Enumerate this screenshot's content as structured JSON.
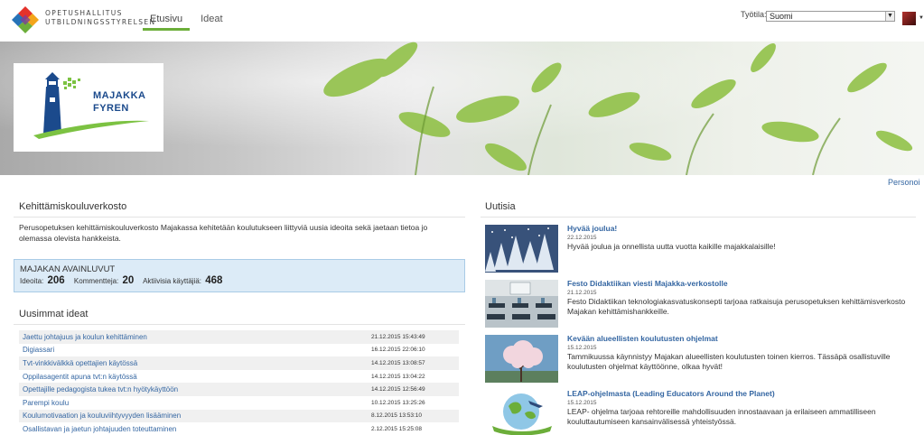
{
  "header": {
    "logo_line1": "OPETUSHALLITUS",
    "logo_line2": "UTBILDNINGSSTYRELSEN",
    "nav": [
      {
        "label": "Etusivu",
        "active": true
      },
      {
        "label": "Ideat",
        "active": false
      }
    ],
    "worklist_label": "Työtila:",
    "worklist_value": "Suomi",
    "accent_color": "#6cae3a",
    "link_color": "#3466a2"
  },
  "banner": {
    "brand_name1": "MAJAKKA",
    "brand_name2": "FYREN",
    "personalize_label": "Personoi"
  },
  "left": {
    "section_title": "Kehittämiskouluverkosto",
    "intro": "Perusopetuksen kehittämiskouluverkosto Majakassa kehitetään koulutukseen liittyviä uusia ideoita sekä jaetaan tietoa jo olemassa olevista hankkeista.",
    "keyfigures": {
      "title": "MAJAKAN AVAINLUVUT",
      "ideas_label": "Ideoita:",
      "ideas_value": "206",
      "comments_label": "Kommentteja:",
      "comments_value": "20",
      "users_label": "Aktiivisia käyttäjiä:",
      "users_value": "468"
    },
    "latest_title": "Uusimmat ideat",
    "ideas": [
      {
        "title": "Jaettu johtajuus ja koulun kehittäminen",
        "date": "21.12.2015 15:43:49"
      },
      {
        "title": "Digiassari",
        "date": "16.12.2015 22:06:10"
      },
      {
        "title": "Tvt-vinkkivälkkä opettajien käytössä",
        "date": "14.12.2015 13:08:57"
      },
      {
        "title": "Oppilasagentit apuna tvt:n käytössä",
        "date": "14.12.2015 13:04:22"
      },
      {
        "title": "Opettajille pedagogista tukea tvt:n hyötykäyttöön",
        "date": "14.12.2015 12:56:49"
      },
      {
        "title": "Parempi koulu",
        "date": "10.12.2015 13:25:26"
      },
      {
        "title": "Koulumotivaation ja kouluviihtyvyyden lisääminen",
        "date": "8.12.2015 13:53:10"
      },
      {
        "title": "Osallistavan ja jaetun johtajuuden toteuttaminen",
        "date": "2.12.2015 15:25:08"
      }
    ]
  },
  "news": {
    "section_title": "Uutisia",
    "items": [
      {
        "title": "Hyvää joulua!",
        "date": "22.12.2015",
        "text": "Hyvää joulua ja onnellista uutta vuotta kaikille majakkalaisille!",
        "icon": "snowy-forest-thumbnail"
      },
      {
        "title": "Festo Didaktiikan viesti Majakka-verkostolle",
        "date": "21.12.2015",
        "text": "Festo Didaktiikan teknologiakasvatuskonsepti tarjoaa ratkaisuja perusopetuksen kehittämisverkosto Majakan kehittämishankkeille.",
        "icon": "classroom-thumbnail"
      },
      {
        "title": "Kevään alueellisten koulutusten ohjelmat",
        "date": "15.12.2015",
        "text": "Tammikuussa käynnistyy Majakan alueellisten koulutusten toinen kierros. Tässäpä osallistuville koulutusten ohjelmat käyttöönne, olkaa hyvät!",
        "icon": "blossom-tree-thumbnail"
      },
      {
        "title": "LEAP-ohjelmasta (Leading Educators Around the Planet)",
        "date": "15.12.2015",
        "text": "LEAP- ohjelma tarjoaa rehtoreille mahdollisuuden innostaavaan ja erilaiseen ammatilliseen kouluttautumiseen kansainvälisessä yhteistyössä.",
        "icon": "leap-globe-thumbnail"
      }
    ]
  }
}
